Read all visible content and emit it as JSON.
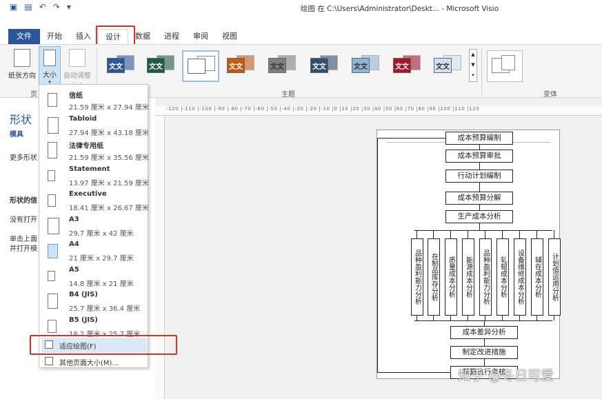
{
  "titlebar": {
    "title": "绘图 在 C:\\Users\\Administrator\\Deskt... - Microsoft Visio",
    "icons": [
      "visio-logo-icon",
      "save-icon",
      "undo-icon",
      "redo-icon",
      "customize-icon"
    ]
  },
  "tabs": [
    {
      "label": "文件"
    },
    {
      "label": "开始"
    },
    {
      "label": "插入"
    },
    {
      "label": "设计"
    },
    {
      "label": "数据"
    },
    {
      "label": "进程"
    },
    {
      "label": "审阅"
    },
    {
      "label": "视图"
    }
  ],
  "ribbon": {
    "orientation_label": "纸张方向",
    "size_label": "大小",
    "autofit_label1": "自动调整",
    "autofit_label2": "大小",
    "page_group_label": "页",
    "themes_group_label": "主题",
    "variants_group_label": "变体",
    "theme_text": "文文"
  },
  "theme_colors": [
    "#2b579a",
    "#1f5c40",
    "#ffffff",
    "#c55a11",
    "#7f7f7f",
    "#2f4f6f",
    "#8fb4d9",
    "#a4162b",
    "#cfe2f3"
  ],
  "left_pane": {
    "title": "形状",
    "sub": "模具",
    "more": "更多形状",
    "info_title": "形状的信",
    "info1": "没有打开",
    "info2": "单击上面",
    "info3": "并打开模"
  },
  "ruler": {
    "labels": "-120 |-110 |-100 |-90 |-80 |-70 |-60 |-50 |-40 |-30 |-20 |-10 |0 |10 |20 |30 |40 |50 |60 |70 |80 |90 |100 |110 |120"
  },
  "page_sizes": [
    {
      "name": "信纸",
      "size": "21.59 厘米 x 27.94 厘米"
    },
    {
      "name": "Tabloid",
      "size": "27.94 厘米 x 43.18 厘米"
    },
    {
      "name": "法律专用纸",
      "size": "21.59 厘米 x 35.56 厘米"
    },
    {
      "name": "Statement",
      "size": "13.97 厘米 x 21.59 厘米"
    },
    {
      "name": "Executive",
      "size": "18.41 厘米 x 26.67 厘米"
    },
    {
      "name": "A3",
      "size": "29.7 厘米 x 42 厘米"
    },
    {
      "name": "A4",
      "size": "21 厘米 x 29.7 厘米"
    },
    {
      "name": "A5",
      "size": "14.8 厘米 x 21 厘米"
    },
    {
      "name": "B4 (JIS)",
      "size": "25.7 厘米 x 36.4 厘米"
    },
    {
      "name": "B5 (JIS)",
      "size": "18.2 厘米 x 25.7 厘米"
    }
  ],
  "dropdown": {
    "fit_label": "适应绘图(F)",
    "more_label": "其他页面大小(M)..."
  },
  "flow": {
    "top": [
      "成本预算编制",
      "成本预算审批",
      "行动计划编制",
      "成本预算分解",
      "生产成本分析"
    ],
    "branches": [
      "品种盈利能力分析",
      "在制品库存分析",
      "质量成本分析",
      "能源成本分析",
      "品种盈利能力分析",
      "轧辊成本分析",
      "设备维修成本分析",
      "辅在成本分析",
      "计划值运用分析"
    ],
    "bottom": [
      "成本差异分析",
      "制定改进措施",
      "预算执行考核"
    ]
  },
  "watermark": "知乎 @冬日可爱"
}
